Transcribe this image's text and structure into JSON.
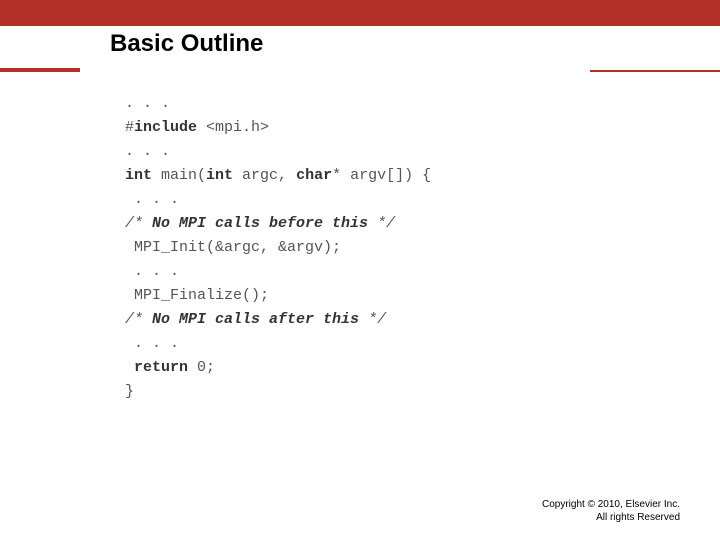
{
  "slide": {
    "title": "Basic Outline",
    "code_lines": [
      {
        "t": ". . ."
      },
      {
        "t": [
          "#",
          {
            "kw": "include"
          },
          " <mpi.h>"
        ]
      },
      {
        "t": ". . ."
      },
      {
        "t": [
          {
            "kw": "int"
          },
          " main(",
          {
            "kw": "int"
          },
          " argc, ",
          {
            "kw": "char"
          },
          "* argv[]) {"
        ]
      },
      {
        "t": " . . ."
      },
      {
        "comment": true,
        "t": [
          "/* ",
          {
            "kw": "No MPI calls before this"
          },
          " */"
        ]
      },
      {
        "t": " MPI_Init(&argc, &argv);"
      },
      {
        "t": " . . ."
      },
      {
        "t": " MPI_Finalize();"
      },
      {
        "comment": true,
        "t": [
          "/* ",
          {
            "kw": "No MPI calls after this"
          },
          " */"
        ]
      },
      {
        "t": " . . ."
      },
      {
        "t": [
          " ",
          {
            "kw": "return"
          },
          " 0;"
        ]
      },
      {
        "t": "}"
      }
    ],
    "copyright_line1": "Copyright © 2010, Elsevier Inc.",
    "copyright_line2": "All rights Reserved"
  }
}
